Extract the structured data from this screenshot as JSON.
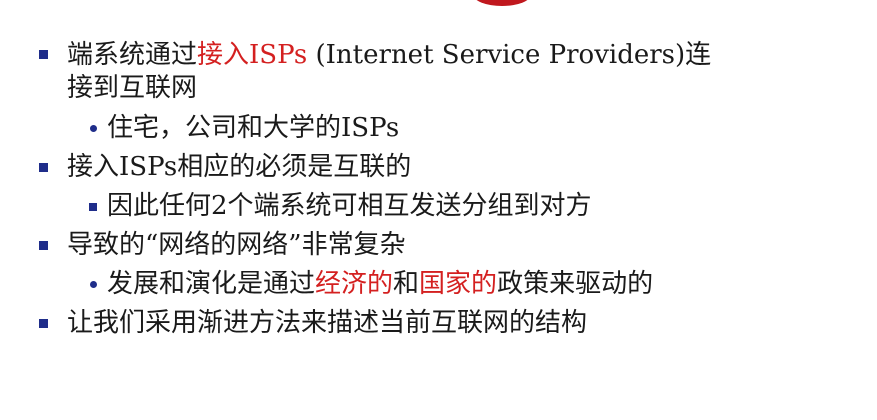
{
  "bullets": [
    {
      "level": 1,
      "marker": "square",
      "text_pre": "端系统通过",
      "text_red": "接入ISPs",
      "text_post": " (Internet Service Providers)连",
      "text_line2": "接到互联网"
    },
    {
      "level": 2,
      "marker": "dot",
      "text": "住宅，公司和大学的ISPs"
    },
    {
      "level": 1,
      "marker": "square",
      "text": "接入ISPs相应的必须是互联的"
    },
    {
      "level": 2,
      "marker": "square",
      "text": "因此任何2个端系统可相互发送分组到对方"
    },
    {
      "level": 1,
      "marker": "square",
      "text": "导致的“网络的网络”非常复杂"
    },
    {
      "level": 2,
      "marker": "dot",
      "text_pre": "发展和演化是通过",
      "text_red1": "经济的",
      "text_mid": "和",
      "text_red2": "国家的",
      "text_post": "政策来驱动的"
    },
    {
      "level": 1,
      "marker": "square",
      "text": "让我们采用渐进方法来描述当前互联网的结构"
    }
  ],
  "colors": {
    "bullet": "#1f2d8a",
    "highlight": "#d42020",
    "text": "#1a1a1a"
  }
}
